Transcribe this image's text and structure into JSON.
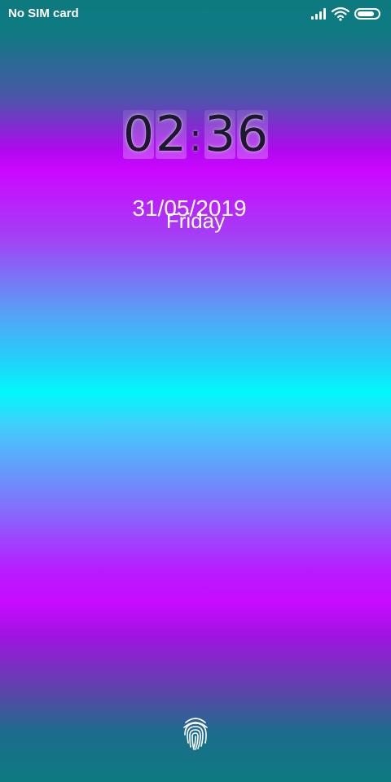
{
  "status_bar": {
    "carrier": "No SIM card",
    "icons": [
      "signal-icon",
      "wifi-icon",
      "battery-icon"
    ],
    "battery_level": 0.85
  },
  "lock_screen": {
    "clock": {
      "h1": "0",
      "h2": "2",
      "separator": ":",
      "m1": "3",
      "m2": "6"
    },
    "date": "31/05/2019",
    "day": "Friday"
  },
  "fingerprint": {
    "icon": "fingerprint-icon"
  },
  "colors": {
    "teal": "#0d7a80",
    "magenta": "#cc07ff",
    "cyan": "#00f8fc",
    "text": "#ffffff",
    "clock_digit": "#1a1a2a"
  }
}
